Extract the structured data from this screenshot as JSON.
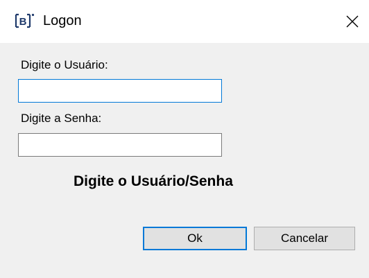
{
  "window": {
    "title": "Logon",
    "icon": "b3-logo-icon",
    "close_glyph": "✕"
  },
  "form": {
    "user_label": "Digite o Usuário:",
    "user_value": "",
    "password_label": "Digite a Senha:",
    "password_value": "",
    "status_message": "Digite o Usuário/Senha"
  },
  "buttons": {
    "ok_label": "Ok",
    "cancel_label": "Cancelar"
  },
  "colors": {
    "accent": "#0078d7",
    "background": "#f0f0f0",
    "titlebar": "#ffffff"
  }
}
